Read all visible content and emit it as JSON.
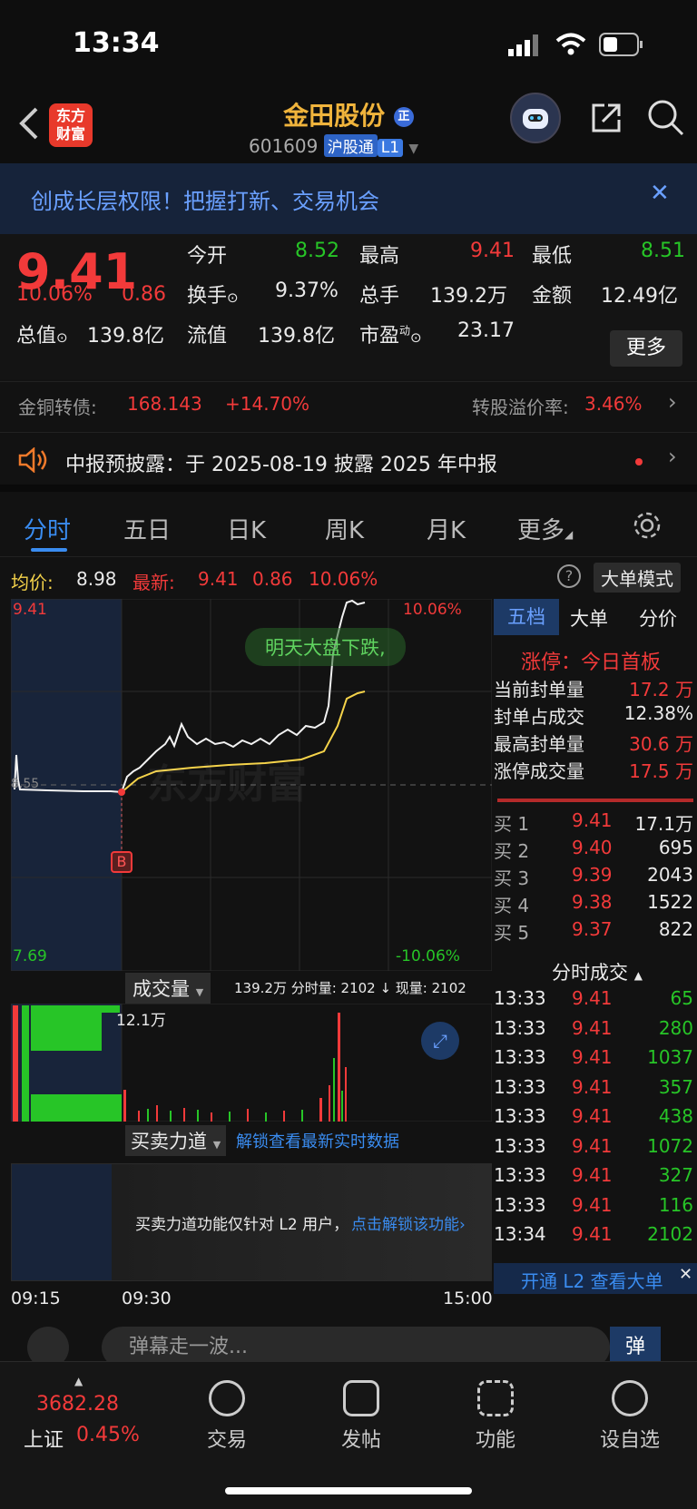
{
  "status": {
    "time": "13:34"
  },
  "header": {
    "logo_line1": "东方",
    "logo_line2": "财富",
    "name": "金田股份",
    "name_badge": "正",
    "code": "601609",
    "tag1": "沪股通",
    "tag2": "L1"
  },
  "banner": {
    "text": "创成长层权限！把握打新、交易机会",
    "close": "✕"
  },
  "quote": {
    "price": "9.41",
    "change_pct": "10.06%",
    "change": "0.86",
    "open_label": "今开",
    "open": "8.52",
    "high_label": "最高",
    "high": "9.41",
    "low_label": "最低",
    "low": "8.51",
    "turnover_label": "换手",
    "turnover": "9.37%",
    "volume_label": "总手",
    "volume": "139.2万",
    "amount_label": "金额",
    "amount": "12.49亿",
    "mktcap_label": "总值",
    "mktcap": "139.8亿",
    "float_label": "流值",
    "float": "139.8亿",
    "pe_label": "市盈",
    "pe_sup": "动",
    "pe": "23.17",
    "more": "更多"
  },
  "bond": {
    "label": "金铜转债:",
    "price": "168.143",
    "pct": "+14.70%",
    "premium_label": "转股溢价率:",
    "premium": "3.46%"
  },
  "notice": {
    "text": "中报预披露：于 2025-08-19 披露 2025 年中报"
  },
  "tabs": [
    "分时",
    "五日",
    "日K",
    "周K",
    "月K",
    "更多"
  ],
  "chart_head": {
    "avg_label": "均价:",
    "avg": "8.98",
    "latest_label": "最新:",
    "latest": "9.41",
    "chg": "0.86",
    "pct": "10.06%",
    "mode": "大单模式"
  },
  "chart": {
    "top_price": "9.41",
    "top_pct": "10.06%",
    "bottom_price": "7.69",
    "bottom_pct": "-10.06%",
    "mid_price": "8.55",
    "danmu": "明天大盘下跌,",
    "watermark": "东方财富",
    "buy_marker": "B"
  },
  "volume_panel": {
    "title": "成交量",
    "stats": "139.2万 分时量: 2102 ↓ 现量: 2102",
    "peak": "12.1万"
  },
  "force_panel": {
    "title": "买卖力道",
    "unlock": "解锁查看最新实时数据",
    "message": "买卖力道功能仅针对 L2 用户，",
    "link": "点击解锁该功能"
  },
  "time_axis": [
    "09:15",
    "09:30",
    "15:00"
  ],
  "side": {
    "tabs": [
      "五档",
      "大单",
      "分价"
    ],
    "limit_up": "涨停：今日首板",
    "stats": [
      {
        "label": "当前封单量",
        "value": "17.2 万",
        "color": "red"
      },
      {
        "label": "封单占成交",
        "value": "12.38%",
        "color": "white"
      },
      {
        "label": "最高封单量",
        "value": "30.6 万",
        "color": "red"
      },
      {
        "label": "涨停成交量",
        "value": "17.5 万",
        "color": "red"
      }
    ],
    "bids": [
      {
        "label": "买 1",
        "price": "9.41",
        "vol": "17.1万"
      },
      {
        "label": "买 2",
        "price": "9.40",
        "vol": "695"
      },
      {
        "label": "买 3",
        "price": "9.39",
        "vol": "2043"
      },
      {
        "label": "买 4",
        "price": "9.38",
        "vol": "1522"
      },
      {
        "label": "买 5",
        "price": "9.37",
        "vol": "822"
      }
    ],
    "trades_title": "分时成交",
    "trades": [
      {
        "t": "13:33",
        "p": "9.41",
        "v": "65"
      },
      {
        "t": "13:33",
        "p": "9.41",
        "v": "280"
      },
      {
        "t": "13:33",
        "p": "9.41",
        "v": "1037"
      },
      {
        "t": "13:33",
        "p": "9.41",
        "v": "357"
      },
      {
        "t": "13:33",
        "p": "9.41",
        "v": "438"
      },
      {
        "t": "13:33",
        "p": "9.41",
        "v": "1072"
      },
      {
        "t": "13:33",
        "p": "9.41",
        "v": "327"
      },
      {
        "t": "13:33",
        "p": "9.41",
        "v": "116"
      },
      {
        "t": "13:34",
        "p": "9.41",
        "v": "2102"
      }
    ],
    "l2_banner": "开通 L2 查看大单"
  },
  "comment": {
    "placeholder": "弹幕走一波...",
    "btn": "弹"
  },
  "bottom_nav": {
    "index_value": "3682.28",
    "index_name": "上证",
    "index_pct": "0.45%",
    "items": [
      "交易",
      "发帖",
      "功能",
      "设自选"
    ]
  }
}
